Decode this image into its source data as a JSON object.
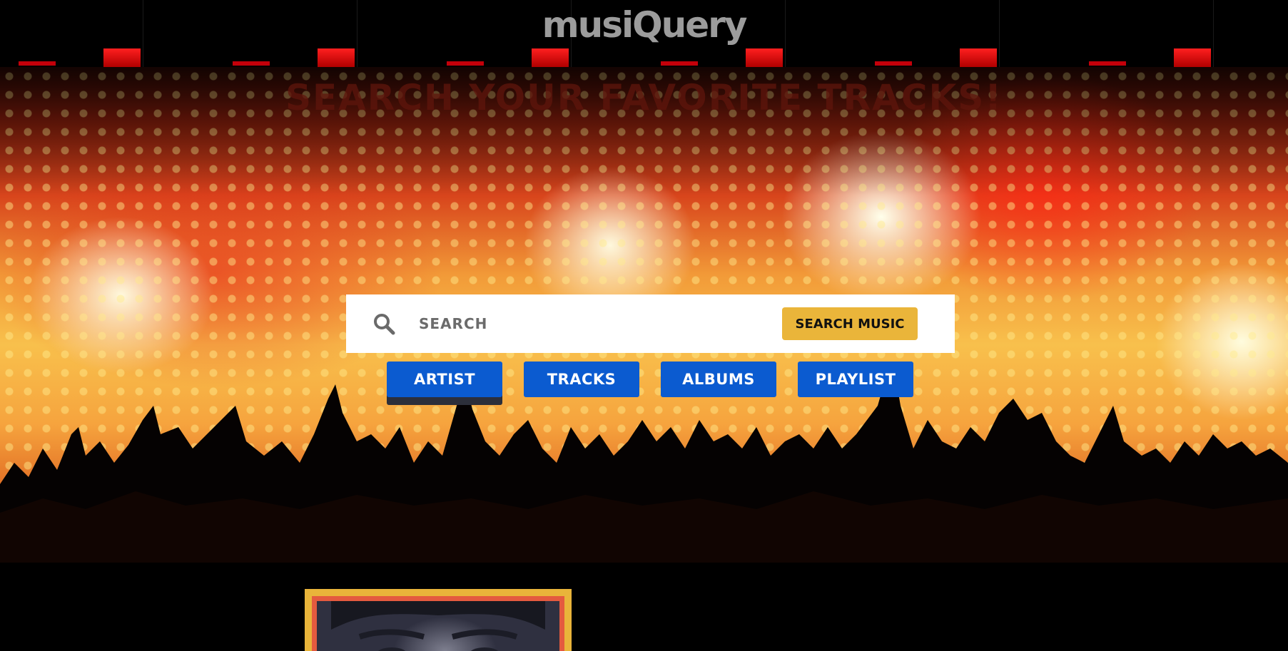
{
  "header": {
    "logo": "musiQuery"
  },
  "hero": {
    "title": "SEARCH YOUR FAVORITE TRACKS!"
  },
  "search": {
    "placeholder": "SEARCH",
    "button_label": "SEARCH MUSIC"
  },
  "categories": [
    {
      "label": "ARTIST",
      "active": true
    },
    {
      "label": "TRACKS",
      "active": false
    },
    {
      "label": "ALBUMS",
      "active": false
    },
    {
      "label": "PLAYLIST",
      "active": false
    }
  ],
  "colors": {
    "search_button": "#eab53a",
    "category_button": "#0b5bd0",
    "card_frame": "#e9b43a"
  },
  "icons": {
    "search": "search-icon"
  }
}
